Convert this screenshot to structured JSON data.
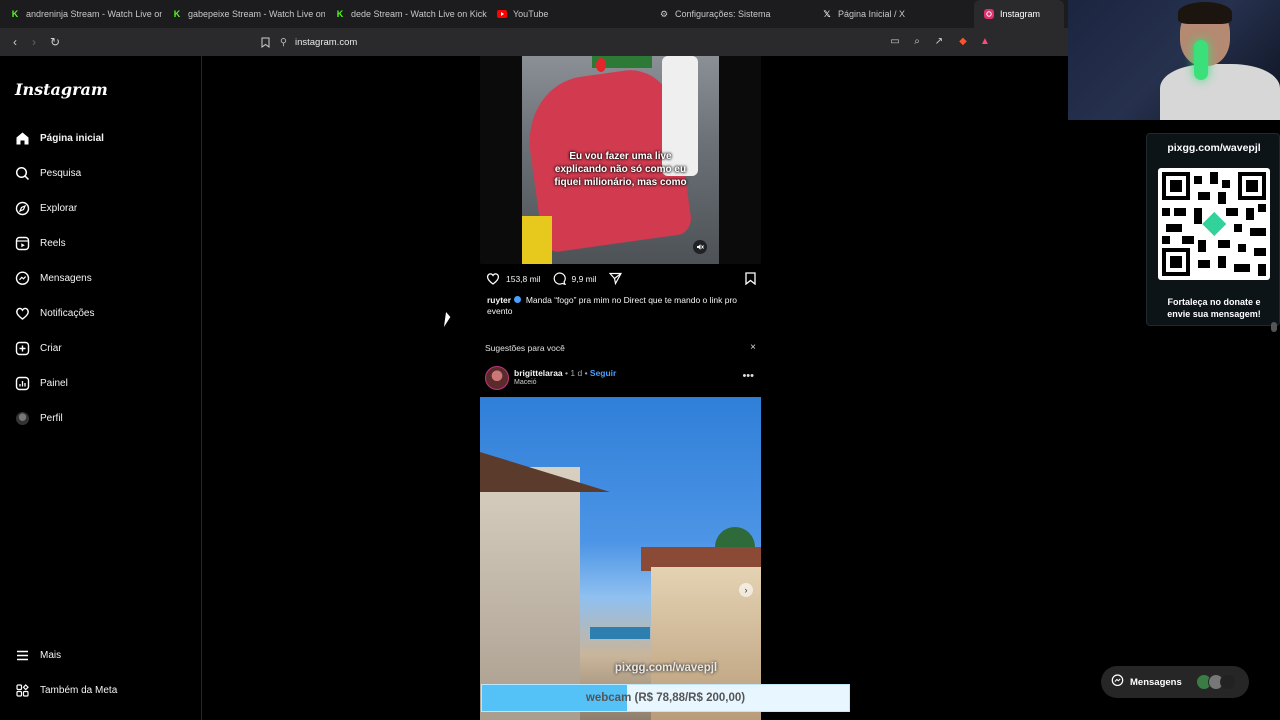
{
  "browser": {
    "tabs": [
      {
        "label": "andreninja Stream - Watch Live on K",
        "icon": "kick-icon"
      },
      {
        "label": "gabepeixe Stream - Watch Live on K",
        "icon": "kick-icon"
      },
      {
        "label": "dede Stream - Watch Live on Kick",
        "icon": "kick-icon"
      },
      {
        "label": "YouTube",
        "icon": "youtube-icon"
      },
      {
        "label": "Configurações: Sistema",
        "icon": "gear-icon"
      },
      {
        "label": "Página Inicial / X",
        "icon": "x-icon"
      },
      {
        "label": "Instagram",
        "icon": "instagram-icon"
      }
    ],
    "active_tab": 6,
    "url": "instagram.com"
  },
  "sidebar": {
    "logo": "Instagram",
    "items": [
      {
        "label": "Página inicial",
        "icon": "home-icon"
      },
      {
        "label": "Pesquisa",
        "icon": "search-icon"
      },
      {
        "label": "Explorar",
        "icon": "compass-icon"
      },
      {
        "label": "Reels",
        "icon": "reels-icon"
      },
      {
        "label": "Mensagens",
        "icon": "messenger-icon"
      },
      {
        "label": "Notificações",
        "icon": "heart-icon"
      },
      {
        "label": "Criar",
        "icon": "plus-square-icon"
      },
      {
        "label": "Painel",
        "icon": "dashboard-icon"
      },
      {
        "label": "Perfil",
        "icon": "avatar-icon"
      }
    ],
    "footer": [
      {
        "label": "Mais",
        "icon": "menu-icon"
      },
      {
        "label": "Também da Meta",
        "icon": "meta-icon"
      }
    ]
  },
  "post": {
    "video_caption": "Eu vou fazer uma live\nexplicando não só como eu\nfiquei milionário, mas como",
    "likes": "153,8 mil",
    "comments": "9,9 mil",
    "author": "ruyter",
    "caption": "Manda “fogo” pra mim no Direct que te mando o link pro evento"
  },
  "suggestions": {
    "title": "Sugestões para você",
    "close": "×",
    "post": {
      "username": "brigittelaraa",
      "time": "1 d",
      "follow": "Seguir",
      "location": "Maceió"
    }
  },
  "stream_overlay": {
    "pix_title": "pixgg.com/wavepjl",
    "pix_bottom": "Fortaleça no donate e\nenvie sua mensagem!",
    "pix_url_center": "pixgg.com/wavepjl",
    "goal_text": "webcam (R$ 78,88/R$ 200,00)",
    "goal_progress": 0.394
  },
  "messages_pill": {
    "label": "Mensagens"
  },
  "colors": {
    "accent_blue": "#4a9fff",
    "goal_fill": "#54c1f7",
    "kick_green": "#53fc18",
    "youtube_red": "#ff0000"
  }
}
